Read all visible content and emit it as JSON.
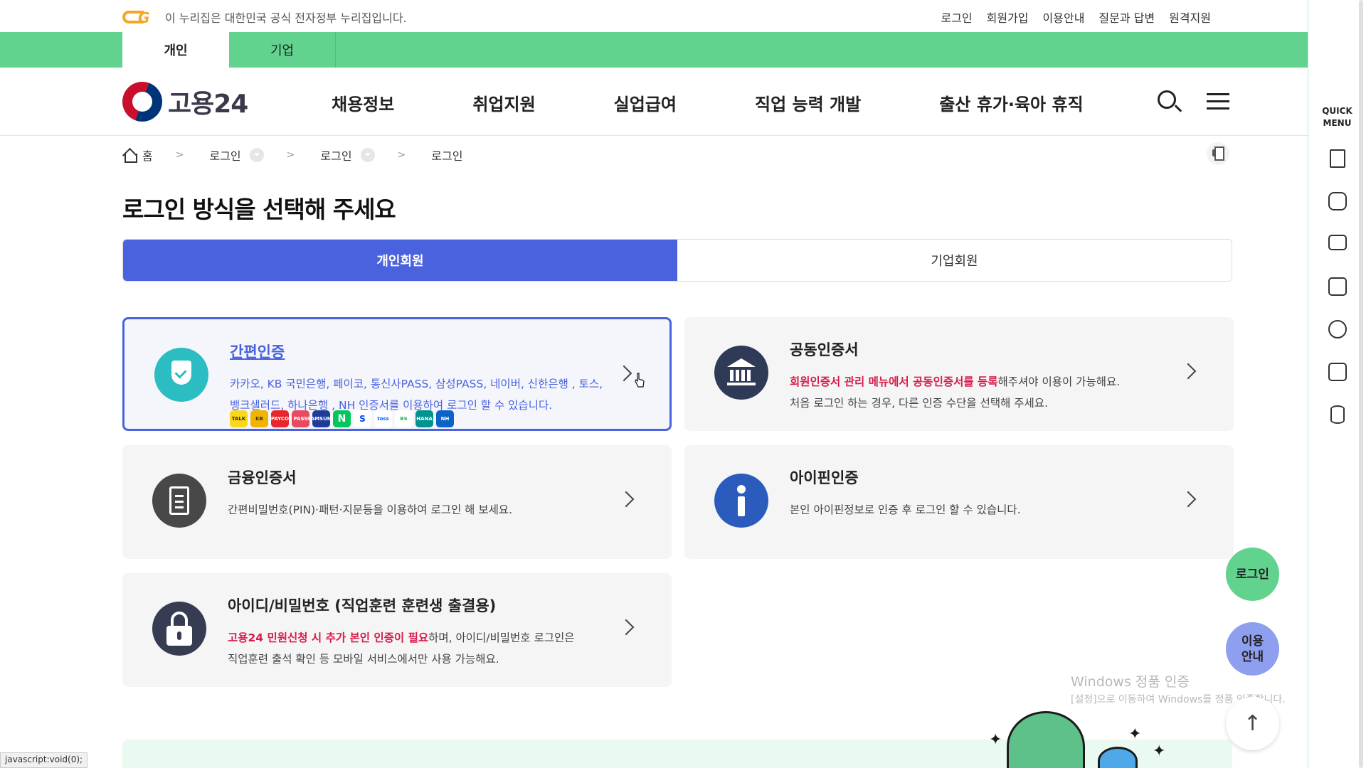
{
  "gov_bar": {
    "notice": "이 누리집은 대한민국 공식 전자정부 누리집입니다.",
    "links": [
      "로그인",
      "회원가입",
      "이용안내",
      "질문과 답변",
      "원격지원"
    ]
  },
  "user_type_tabs": [
    {
      "label": "개인",
      "active": true
    },
    {
      "label": "기업",
      "active": false
    }
  ],
  "header": {
    "logo_text": "고용24",
    "nav": [
      "채용정보",
      "취업지원",
      "실업급여",
      "직업 능력 개발",
      "출산 휴가·육아 휴직"
    ]
  },
  "breadcrumb": {
    "home": "홈",
    "items": [
      "로그인",
      "로그인",
      "로그인"
    ]
  },
  "page_title": "로그인 방식을 선택해 주세요",
  "member_tabs": [
    {
      "label": "개인회원",
      "active": true
    },
    {
      "label": "기업회원",
      "active": false
    }
  ],
  "login_methods": {
    "simple": {
      "title": "간편인증",
      "desc": "카카오, KB 국민은행, 페이코, 통신사PASS, 삼성PASS, 네이버, 신한은행 , 토스, 뱅크샐러드, 하나은행 , NH 인증서를 이용하여 로그인 할 수 있습니다.",
      "providers": [
        {
          "label": "TALK",
          "color": "#f9d71c",
          "text_color": "#3a1d1d"
        },
        {
          "label": "KB",
          "color": "#f2b200",
          "text_color": "#333333"
        },
        {
          "label": "PAYCO",
          "color": "#e8262c",
          "text_color": "#ffffff"
        },
        {
          "label": "PASS",
          "color": "#e84a5f",
          "text_color": "#ffffff"
        },
        {
          "label": "SAMSUNG",
          "color": "#1f3c99",
          "text_color": "#ffffff"
        },
        {
          "label": "N",
          "color": "#03c75a",
          "text_color": "#ffffff"
        },
        {
          "label": "S",
          "color": "#ffffff",
          "text_color": "#0046ff"
        },
        {
          "label": "toss",
          "color": "#ffffff",
          "text_color": "#0064ff"
        },
        {
          "label": "BS",
          "color": "#ffffff",
          "text_color": "#25b35a"
        },
        {
          "label": "HANA",
          "color": "#009490",
          "text_color": "#ffffff"
        },
        {
          "label": "NH",
          "color": "#0b62c8",
          "text_color": "#ffffff"
        }
      ]
    },
    "joint": {
      "title": "공동인증서",
      "desc_red": "회원인증서 관리 메뉴에서 공동인증서를 등록",
      "desc_rest": "해주셔야 이용이 가능해요.",
      "desc_line2": "처음 로그인 하는 경우, 다른 인증 수단을 선택해 주세요."
    },
    "finance": {
      "title": "금융인증서",
      "desc": "간편비밀번호(PIN)·패턴·지문등을 이용하여 로그인 해 보세요."
    },
    "ipin": {
      "title": "아이핀인증",
      "desc": "본인 아이핀정보로 인증 후 로그인 할 수 있습니다."
    },
    "idpw": {
      "title": "아이디/비밀번호 (직업훈련 훈련생 출결용)",
      "desc_red": "고용24 민원신청 시 추가 본인 인증이 필요",
      "desc_rest": "하며, 아이디/비밀번호 로그인은",
      "desc_line2": "직업훈련 출석 확인 등 모바일 서비스에서만 사용 가능해요."
    }
  },
  "quick_menu": {
    "title_line1": "QUICK",
    "title_line2": "MENU",
    "icons": [
      "building-icon",
      "chat-icon",
      "monitor-icon",
      "checklist-icon",
      "smile-icon",
      "calculator-icon",
      "database-icon"
    ]
  },
  "floating": {
    "login": "로그인",
    "guide_line1": "이용",
    "guide_line2": "안내",
    "top": "↑"
  },
  "watermark": {
    "line1": "Windows 정품 인증",
    "line2": "[설정]으로 이동하여 Windows를 정품 인증합니다."
  },
  "status_url": "javascript:void(0);",
  "colors": {
    "primary_green": "#62d38f",
    "accent_blue": "#4a62dd",
    "alert_red": "#d81b4a"
  }
}
